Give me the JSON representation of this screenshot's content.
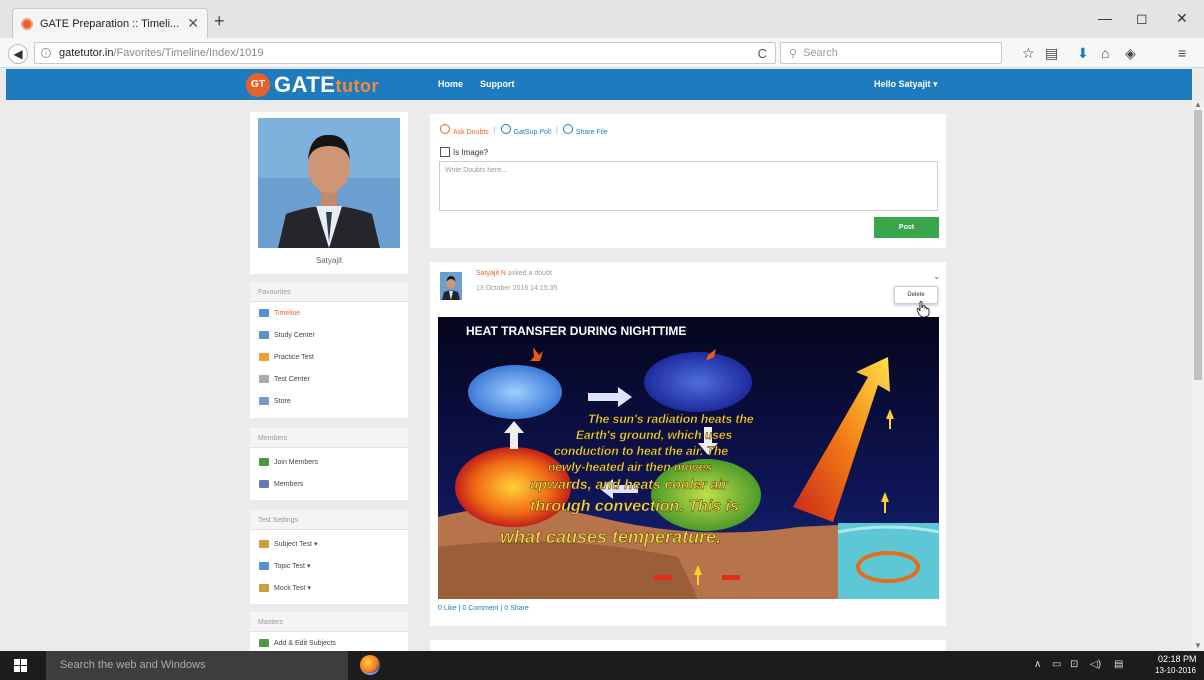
{
  "browser": {
    "tab_title": "GATE Preparation :: Timeli...",
    "tab_close": "✕",
    "new_tab": "+",
    "url_domain": "gatetutor.in",
    "url_path": "/Favorites/Timeline/Index/1019",
    "reload_icon": "C",
    "search_placeholder": "Search",
    "window_controls": [
      "—",
      "◻",
      "✕"
    ]
  },
  "site": {
    "logo_badge": "GT",
    "logo_gate": "GATE",
    "logo_tutor": "tutor",
    "nav": [
      "Home",
      "Support"
    ],
    "greeting": "Hello Satyajit ▾"
  },
  "profile": {
    "name": "Satyajit"
  },
  "sidebar": {
    "favourites": {
      "title": "Favourites",
      "items": [
        {
          "label": "Timeline",
          "icon": "timeline-icon",
          "color": "#5b8fd0",
          "active": true
        },
        {
          "label": "Study Center",
          "icon": "study-center-icon",
          "color": "#5b8fd0"
        },
        {
          "label": "Practice Test",
          "icon": "practice-test-icon",
          "color": "#f0a030"
        },
        {
          "label": "Test Center",
          "icon": "test-center-icon",
          "color": "#aaaaaa"
        },
        {
          "label": "Store",
          "icon": "store-icon",
          "color": "#7a9ac8"
        }
      ]
    },
    "members": {
      "title": "Members",
      "items": [
        {
          "label": "Join Members",
          "icon": "join-members-icon",
          "color": "#4a9a40"
        },
        {
          "label": "Members",
          "icon": "members-icon",
          "color": "#6a7ab8"
        }
      ]
    },
    "test_settings": {
      "title": "Test Settings",
      "items": [
        {
          "label": "Subject Test ▾",
          "icon": "subject-test-icon",
          "color": "#c8a040"
        },
        {
          "label": "Topic Test ▾",
          "icon": "topic-test-icon",
          "color": "#5b8fd0"
        },
        {
          "label": "Mock Test ▾",
          "icon": "mock-test-icon",
          "color": "#c8a040"
        }
      ]
    },
    "masters": {
      "title": "Masters",
      "items": [
        {
          "label": "Add & Edit Subjects",
          "icon": "subjects-icon",
          "color": "#4a9a40"
        }
      ]
    }
  },
  "composer": {
    "tab_ask": "Ask Doubts",
    "tab_poll": "GatSup Poll",
    "tab_share": "Share File",
    "separator": "|",
    "is_image_label": "Is Image?",
    "placeholder": "Write Doubts here...",
    "post_label": "Post"
  },
  "post": {
    "author": "Satyajit N",
    "action": "asked a doubt",
    "date": "13 October 2016 14:15:35",
    "menu_delete": "Delete",
    "chevron": "⌄",
    "stats": "0 Like | 0 Comment | 0 Share",
    "image": {
      "title": "HEAT TRANSFER DURING NIGHTTIME",
      "caption_1": "The sun's radiation heats the",
      "caption_2": "Earth's ground, which uses",
      "caption_3": "conduction to heat the air. The",
      "caption_4": "newly-heated air then moves",
      "caption_5": "upwards, and heats cooler air",
      "caption_6": "through convection. This is",
      "caption_7": "what causes temperature."
    }
  },
  "taskbar": {
    "search_text": "Search the web and Windows",
    "time": "02:18 PM",
    "date": "13-10-2016"
  }
}
